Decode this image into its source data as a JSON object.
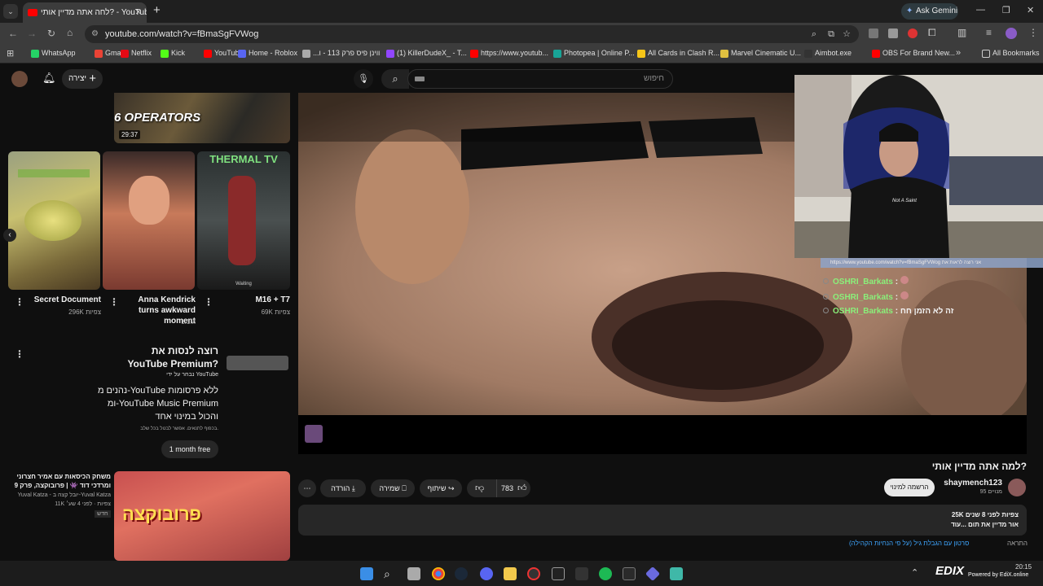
{
  "browser": {
    "tab_title": "לחה אתה מדיין אותי? - YouTube",
    "address": "youtube.com/watch?v=fBmaSgFVWog",
    "gemini_label": "Ask Gemini",
    "all_bookmarks": "All Bookmarks",
    "bookmarks": [
      {
        "label": "WhatsApp",
        "color": "#25d366"
      },
      {
        "label": "Gmail",
        "color": "#ea4335"
      },
      {
        "label": "Netflix",
        "color": "#e50914"
      },
      {
        "label": "Kick",
        "color": "#53fc18"
      },
      {
        "label": "YouTube",
        "color": "#ff0000"
      },
      {
        "label": "Home - Roblox",
        "color": "#5865f2"
      },
      {
        "label": "...ווינן פיס פרק 113 - ו",
        "color": "#aaaaaa"
      },
      {
        "label": "(1) KillerDudeX_ - T...",
        "color": "#9146ff"
      },
      {
        "label": "https://www.youtub...",
        "color": "#ff0000"
      },
      {
        "label": "Photopea | Online P...",
        "color": "#18a497"
      },
      {
        "label": "All Cards in Clash R...",
        "color": "#f5c518"
      },
      {
        "label": "Marvel Cinematic U...",
        "color": "#e0c040"
      },
      {
        "label": "Aimbot.exe",
        "color": "#333333"
      },
      {
        "label": "OBS For Brand New...",
        "color": "#ff0000"
      }
    ]
  },
  "youtube": {
    "create_label": "יצירה",
    "search_placeholder": "חיפוש",
    "video_title": "למה אתה מדיין אותי?",
    "channel": {
      "name": "shaymench123",
      "subs": "95 מנויים",
      "subscribe": "הרשמה למינוי"
    },
    "actions": {
      "likes": "783",
      "share": "שיתוף",
      "save": "שמירה",
      "download": "הורדה"
    },
    "description": {
      "views": "25K צפיות  לפני 8 שנים",
      "text": "אור מדיין את תום   ...עוד"
    },
    "footer_left": "סרטון עם הגבלת גיל (על פי הנחיות הקהילה)",
    "footer_right": "התראה"
  },
  "sidebar": {
    "top_thumb": {
      "text": "6 OPERATORS",
      "duration": "29:37"
    },
    "shorts": [
      {
        "title": "Secret Document",
        "views": "296K צפיות"
      },
      {
        "title": "Anna Kendrick turns awkward moment",
        "views": "1.1M"
      },
      {
        "title": "M16 + T7",
        "views": "69K צפיות",
        "overlay": "THERMAL TV",
        "caption": "Waiting"
      }
    ],
    "premium": {
      "title": "רוצה לנסות את YouTube Premium?",
      "byline": "נבחר על ידי YouTube",
      "body": "נהנים מ-YouTube ללא פרסומות ומ-YouTube Music Premium והכול במינוי אחד",
      "fine": "בכפוף לתנאים. אפשר לבטל בכל שלב.",
      "cta": "1 month free"
    },
    "rec": {
      "title": "משחק הכיסאות עם אמיר חצרוני ומרדכי דוד 👾 | פרובוקצה, פרק 9",
      "channel": "Yuval Katza - יובל קצה ב-Yuval Katza",
      "meta": "11K צפיות · לפני 4 שע׳",
      "badge": "חדש",
      "thumb_text": "פרובוקצה"
    }
  },
  "stream": {
    "url": "https://www.youtube.com/watch?v=fBmaSgFVWog   אני רוצה לראות את",
    "shirt": "Not A Saint",
    "chat": [
      {
        "user": "OSHRI_Barkats",
        "msg": ":"
      },
      {
        "user": "OSHRI_Barkats",
        "msg": ":"
      },
      {
        "user": "OSHRI_Barkats",
        "msg": ": זה לא הזמן חח"
      }
    ]
  },
  "taskbar": {
    "time": "20:15",
    "tray_brand": "EDIX",
    "tray_text": "Powered by EdiX.online"
  }
}
